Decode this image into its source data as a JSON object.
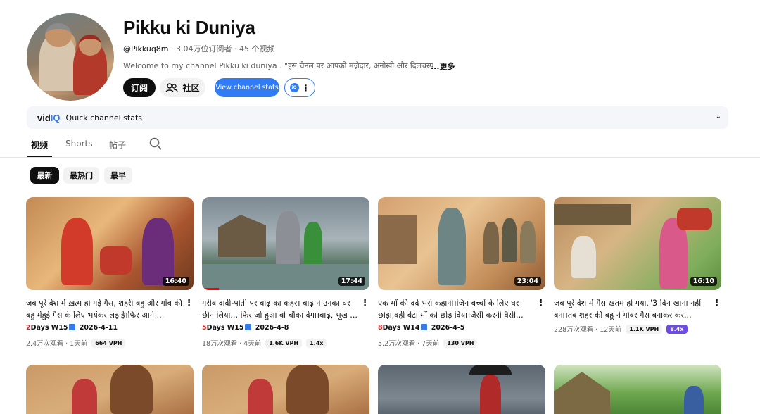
{
  "channel": {
    "name": "Pikku ki Duniya",
    "handle": "@Pikkuq8m",
    "meta": " · 3.04万位订阅者 · 45 个视频",
    "description": "Welcome to my channel Pikku ki duniya . \"इस चैनल पर आपको मज़ेदार, अनोखी और दिलचस्प का",
    "more": "...更多"
  },
  "buttons": {
    "subscribe": "订阅",
    "community": "社区",
    "view_stats": "View channel stats"
  },
  "vidiq": {
    "logo_prefix": "vid",
    "logo_suffix": "IQ",
    "label": "Quick channel stats",
    "chevron": "⌄"
  },
  "tabs": [
    "视频",
    "Shorts",
    "帖子"
  ],
  "chips": [
    "最新",
    "最热门",
    "最早"
  ],
  "videos": [
    {
      "title": "जब पूरे देश में ख़त्म हो गई गैस, शहरी बहु और गाँव की बहु मेंहुई गैस के लिए भयंकर लड़ाई।फिर आगे ...",
      "duration": "16:40",
      "days": "2",
      "days_rest": "Days W15",
      "date": "2026-4-11",
      "views": "2.4万次观看 · 1天前",
      "vph": "664 VPH",
      "multiplier": ""
    },
    {
      "title": "गरीब दादी-पोती पर बाढ़ का कहर। बाढ़ ने उनका घर छीन लिया... फिर जो हुआ वो चौंका देगा।बाढ़, भूख ...",
      "duration": "17:44",
      "days": "5",
      "days_rest": "Days W15",
      "date": "2026-4-8",
      "views": "18万次观看 · 4天前",
      "vph": "1.6K VPH",
      "multiplier": "1.4x"
    },
    {
      "title": "एक माँ की दर्द भरी कहानी।जिन बच्चों के लिए घर छोड़ा,वही बेटा माँ को छोड़ दिया।जैसी करनी वैसी...",
      "duration": "23:04",
      "days": "8",
      "days_rest": "Days W14",
      "date": "2026-4-5",
      "views": "5.2万次观看 · 7天前",
      "vph": "130 VPH",
      "multiplier": ""
    },
    {
      "title": "जब पूरे देश में गैस ख़तम हो गया,\"3 दिन खाना नहीं बना।तब शहर की बहू ने गोबर गैस बनाकर कर...",
      "duration": "16:10",
      "days": "",
      "days_rest": "",
      "date": "",
      "views": "228万次观看 · 12天前",
      "vph": "1.1K VPH",
      "multiplier": "8.4x"
    }
  ],
  "colors": {
    "accent_blue": "#2f7cf6",
    "red": "#ff0000",
    "purple": "#6e4be6"
  }
}
